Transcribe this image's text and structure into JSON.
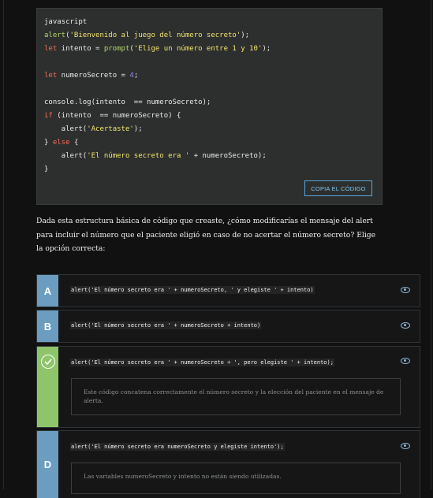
{
  "code_block": {
    "language": "javascript",
    "lines": [
      [
        {
          "t": "javascript",
          "c": "plain"
        }
      ],
      [
        {
          "t": "alert",
          "c": "fn"
        },
        {
          "t": "(",
          "c": "plain"
        },
        {
          "t": "'Bienvenido al juego del número secreto'",
          "c": "str"
        },
        {
          "t": ");",
          "c": "plain"
        }
      ],
      [
        {
          "t": "let",
          "c": "kw"
        },
        {
          "t": " intento = ",
          "c": "plain"
        },
        {
          "t": "prompt",
          "c": "fn"
        },
        {
          "t": "(",
          "c": "plain"
        },
        {
          "t": "'Elige un número entre 1 y 10'",
          "c": "str"
        },
        {
          "t": ");",
          "c": "plain"
        }
      ],
      [],
      [
        {
          "t": "let",
          "c": "kw"
        },
        {
          "t": " numeroSecreto = ",
          "c": "plain"
        },
        {
          "t": "4",
          "c": "num"
        },
        {
          "t": ";",
          "c": "plain"
        }
      ],
      [],
      [
        {
          "t": "console.log(intento  == numeroSecreto);",
          "c": "plain"
        }
      ],
      [
        {
          "t": "if",
          "c": "kw"
        },
        {
          "t": " (intento  == numeroSecreto) {",
          "c": "plain"
        }
      ],
      [
        {
          "t": "    alert(",
          "c": "plain"
        },
        {
          "t": "'Acertaste'",
          "c": "str"
        },
        {
          "t": ");",
          "c": "plain"
        }
      ],
      [
        {
          "t": "} ",
          "c": "plain"
        },
        {
          "t": "else",
          "c": "kw"
        },
        {
          "t": " {",
          "c": "plain"
        }
      ],
      [
        {
          "t": "    alert(",
          "c": "plain"
        },
        {
          "t": "'El número secreto era '",
          "c": "str"
        },
        {
          "t": " + numeroSecreto);",
          "c": "plain"
        }
      ],
      [
        {
          "t": "}",
          "c": "plain"
        }
      ]
    ],
    "copy_label": "COPIA EL CÓDIGO"
  },
  "question": "Dada esta estructura básica de código que creaste, ¿cómo modificarías el mensaje del alert para incluir el número que el paciente eligió en caso de no acertar el número secreto?  Elige la opción correcta:",
  "options": [
    {
      "letter": "A",
      "code": "alert('El número secreto era ' + numeroSecreto, ' y elegiste ' + intento)"
    },
    {
      "letter": "B",
      "code": "alert('El número secreto era ' + numeroSecreto + intento)"
    },
    {
      "letter": "",
      "code": "alert('El número secreto era ' + numeroSecreto + ', pero elegiste ' + intento);",
      "feedback": "Este código concatena correctamente el número secreto y la elección del paciente en el mensaje de alerta."
    },
    {
      "letter": "D",
      "code": "alert('El número secreto era numeroSecreto y elegiste intento');",
      "feedback": "Las variables numeroSecreto y intento no están siendo utilizadas."
    }
  ],
  "colors": {
    "option_bar": "#6a9dc0",
    "correct_bar": "#8ec56a",
    "accent": "#5aa7dd"
  },
  "icons": {
    "view": "eye-icon",
    "correct": "check-circle-icon"
  }
}
